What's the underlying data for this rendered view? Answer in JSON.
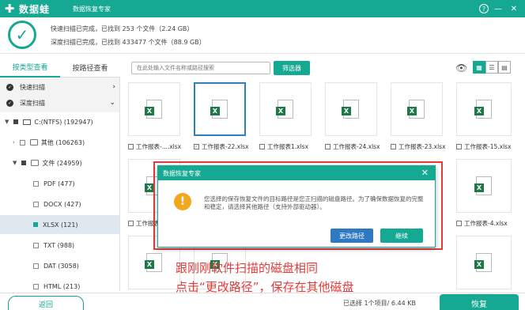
{
  "titlebar": {
    "brand": "数据蛙",
    "app_title": "数据恢复专家",
    "help": "?",
    "minimize": "—",
    "close": "✕"
  },
  "summary": {
    "quick": "快速扫描已完成，已找到 253 个文件（2.24 GB）",
    "deep": "深度扫描已完成，已找到 433477 个文件（88.9 GB）"
  },
  "tabs": {
    "by_type": "按类型查看",
    "by_path": "按路径查看"
  },
  "sidebar": {
    "quick_scan": "快速扫描",
    "deep_scan": "深度扫描",
    "drive": "C:(NTFS) (192947)",
    "other": "其他 (106263)",
    "documents": "文件 (24959)",
    "pdf": "PDF (477)",
    "docx": "DOCX (427)",
    "xlsx": "XLSX (121)",
    "txt": "TXT (988)",
    "dat": "DAT (3058)",
    "html": "HTML (213)"
  },
  "toolbar": {
    "search_placeholder": "在此处输入文件名称或路径搜索",
    "filter": "筛选器"
  },
  "files": [
    {
      "name": "工作报表-....xlsx",
      "checked": false
    },
    {
      "name": "工作报表-22.xlsx",
      "checked": true
    },
    {
      "name": "工作报表1.xlsx",
      "checked": false
    },
    {
      "name": "工作报表-24.xlsx",
      "checked": false
    },
    {
      "name": "工作报表-23.xlsx",
      "checked": false
    },
    {
      "name": "工作报表-15.xlsx",
      "checked": false
    },
    {
      "name": "工作报表-....",
      "checked": false
    },
    {
      "name": "工作报表-4.xlsx",
      "checked": false
    }
  ],
  "dialog": {
    "title": "数据恢复专家",
    "close": "✕",
    "line1": "您选择的保存恢复文件的目标路径是您正扫描的磁盘路径。为了确保数据恢复的完整",
    "line2": "和稳定，请选择其他路径（支持外部驱动器）。",
    "change_path": "更改路径",
    "continue": "继续"
  },
  "caption": {
    "line1": "跟刚刚软件扫描的磁盘相同",
    "line2": "点击“更改路径”，保存在其他磁盘"
  },
  "bottom": {
    "back": "返回",
    "status": "已选择 1个项目/ 6.44 KB",
    "recover": "恢复"
  },
  "colors": {
    "primary": "#15a893",
    "dialog_button": "#2f79c2",
    "warning": "#f3a71d",
    "caption_red": "#e53a3a"
  }
}
